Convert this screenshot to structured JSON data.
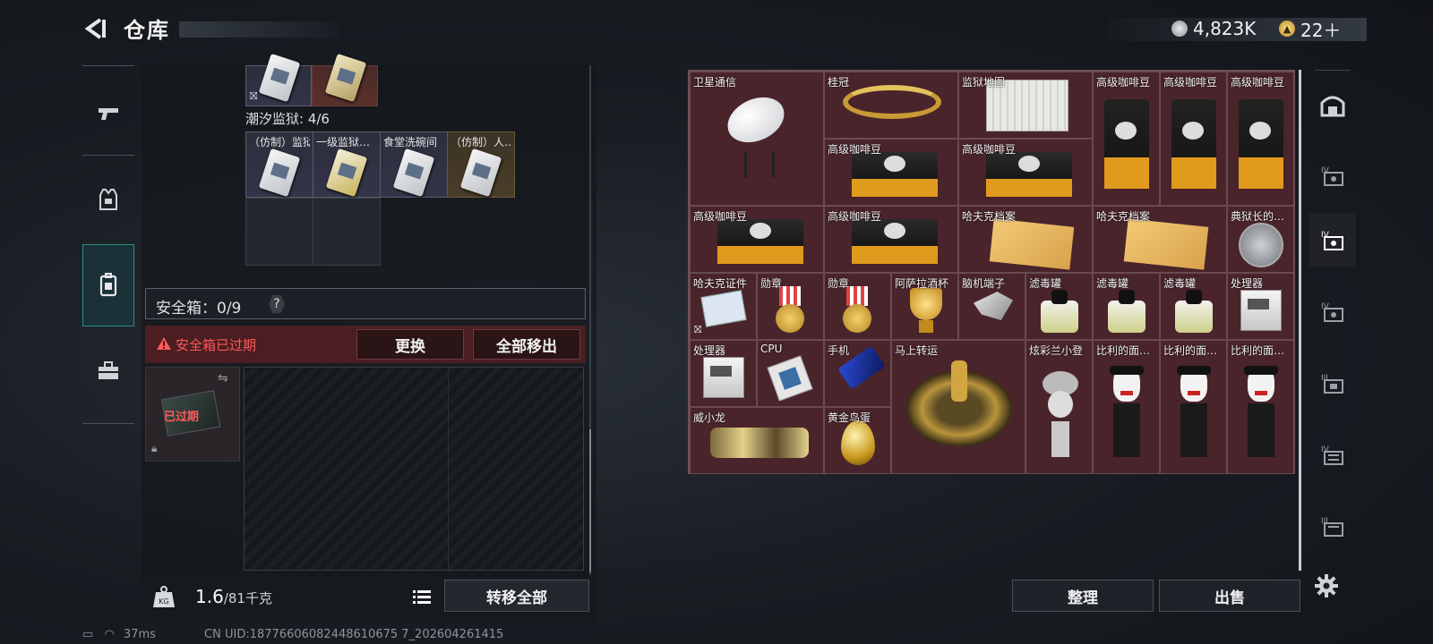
{
  "header": {
    "title": "仓库",
    "currencies": [
      {
        "icon": "silver-coin-icon",
        "value": "4,823K"
      },
      {
        "icon": "gold-coin-icon",
        "value": "22＋"
      }
    ]
  },
  "left_nav": {
    "items": [
      {
        "name": "weapon",
        "icon": "pistol-icon",
        "active": false
      },
      {
        "name": "armor",
        "icon": "vest-icon",
        "active": false
      },
      {
        "name": "backpack",
        "icon": "backpack-icon",
        "active": true
      },
      {
        "name": "kit",
        "icon": "toolbox-icon",
        "active": false
      }
    ]
  },
  "container_section": {
    "name": "潮汐监狱: 4/6",
    "slots": [
      {
        "label": "（仿制）监狱…"
      },
      {
        "label": "一级监狱…"
      },
      {
        "label": "食堂洗碗间"
      },
      {
        "label": "（仿制）人…"
      }
    ]
  },
  "safebox": {
    "label": "安全箱：0/9",
    "help": "?",
    "expired_notice": "安全箱已过期",
    "replace_button": "更换",
    "remove_all_button": "全部移出",
    "thumb_status": "已过期"
  },
  "weight": {
    "current": "1.6",
    "max_unit": "/81千克",
    "transfer_all_button": "转移全部"
  },
  "stash": {
    "items": [
      {
        "label": "卫星通信",
        "art": "dish"
      },
      {
        "label": "桂冠",
        "art": "laurel"
      },
      {
        "label": "监狱地图",
        "art": "map"
      },
      {
        "label": "高级咖啡豆",
        "art": "bag"
      },
      {
        "label": "高级咖啡豆",
        "art": "bag"
      },
      {
        "label": "高级咖啡豆",
        "art": "bag"
      },
      {
        "label": "高级咖啡豆",
        "art": "bagh"
      },
      {
        "label": "高级咖啡豆",
        "art": "bagh"
      },
      {
        "label": "高级咖啡豆",
        "art": "bagh"
      },
      {
        "label": "高级咖啡豆",
        "art": "bagh"
      },
      {
        "label": "哈夫克档案",
        "art": "folder"
      },
      {
        "label": "哈夫克档案",
        "art": "folder"
      },
      {
        "label": "典狱长的…",
        "art": "badge"
      },
      {
        "label": "哈夫克证件",
        "art": "card"
      },
      {
        "label": "勋章",
        "art": "medal"
      },
      {
        "label": "勋章",
        "art": "medal"
      },
      {
        "label": "阿萨拉酒杯",
        "art": "cup"
      },
      {
        "label": "脑机端子",
        "art": "chip"
      },
      {
        "label": "滤毒罐",
        "art": "can"
      },
      {
        "label": "滤毒罐",
        "art": "can"
      },
      {
        "label": "滤毒罐",
        "art": "can"
      },
      {
        "label": "处理器",
        "art": "box"
      },
      {
        "label": "处理器",
        "art": "box"
      },
      {
        "label": "CPU",
        "art": "cpu"
      },
      {
        "label": "手机",
        "art": "phone"
      },
      {
        "label": "马上转运",
        "art": "wheel"
      },
      {
        "label": "炫彩兰小登",
        "art": "doll"
      },
      {
        "label": "比利的面…",
        "art": "puppet"
      },
      {
        "label": "比利的面…",
        "art": "puppet"
      },
      {
        "label": "比利的面…",
        "art": "puppet"
      },
      {
        "label": "威小龙",
        "art": "dragon"
      },
      {
        "label": "黄金鸟蛋",
        "art": "egg"
      }
    ],
    "sort_button": "整理",
    "sell_button": "出售"
  },
  "right_nav": {
    "items": [
      {
        "icon": "vault-icon"
      },
      {
        "icon": "shelf-4-icon"
      },
      {
        "icon": "shelf-active-icon",
        "active": true
      },
      {
        "icon": "shelf-4b-icon"
      },
      {
        "icon": "shelf-3-icon"
      },
      {
        "icon": "shelf-4c-icon"
      },
      {
        "icon": "shelf-3b-icon"
      }
    ]
  },
  "status": {
    "ping": "37ms",
    "uid": "CN UID:18776606082448610675 7_202604261415"
  },
  "colors": {
    "accent_teal": "#2c8f86",
    "expired_red": "#ff5a5a",
    "stash_bg": "#4a242b"
  }
}
